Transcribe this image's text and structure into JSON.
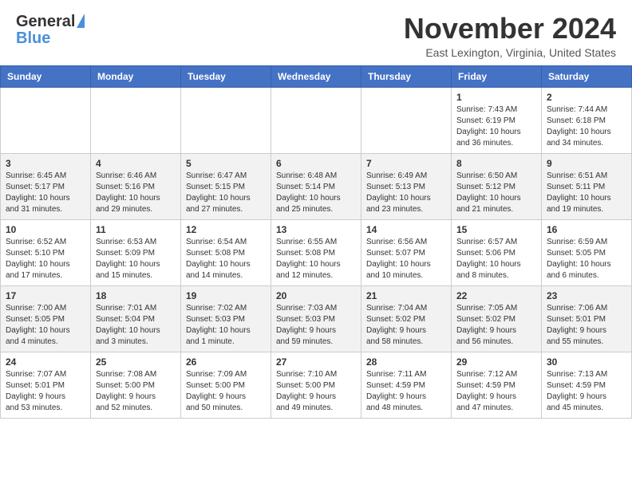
{
  "header": {
    "logo_general": "General",
    "logo_blue": "Blue",
    "title": "November 2024",
    "location": "East Lexington, Virginia, United States"
  },
  "calendar": {
    "days_of_week": [
      "Sunday",
      "Monday",
      "Tuesday",
      "Wednesday",
      "Thursday",
      "Friday",
      "Saturday"
    ],
    "weeks": [
      [
        {
          "day": "",
          "info": ""
        },
        {
          "day": "",
          "info": ""
        },
        {
          "day": "",
          "info": ""
        },
        {
          "day": "",
          "info": ""
        },
        {
          "day": "",
          "info": ""
        },
        {
          "day": "1",
          "info": "Sunrise: 7:43 AM\nSunset: 6:19 PM\nDaylight: 10 hours\nand 36 minutes."
        },
        {
          "day": "2",
          "info": "Sunrise: 7:44 AM\nSunset: 6:18 PM\nDaylight: 10 hours\nand 34 minutes."
        }
      ],
      [
        {
          "day": "3",
          "info": "Sunrise: 6:45 AM\nSunset: 5:17 PM\nDaylight: 10 hours\nand 31 minutes."
        },
        {
          "day": "4",
          "info": "Sunrise: 6:46 AM\nSunset: 5:16 PM\nDaylight: 10 hours\nand 29 minutes."
        },
        {
          "day": "5",
          "info": "Sunrise: 6:47 AM\nSunset: 5:15 PM\nDaylight: 10 hours\nand 27 minutes."
        },
        {
          "day": "6",
          "info": "Sunrise: 6:48 AM\nSunset: 5:14 PM\nDaylight: 10 hours\nand 25 minutes."
        },
        {
          "day": "7",
          "info": "Sunrise: 6:49 AM\nSunset: 5:13 PM\nDaylight: 10 hours\nand 23 minutes."
        },
        {
          "day": "8",
          "info": "Sunrise: 6:50 AM\nSunset: 5:12 PM\nDaylight: 10 hours\nand 21 minutes."
        },
        {
          "day": "9",
          "info": "Sunrise: 6:51 AM\nSunset: 5:11 PM\nDaylight: 10 hours\nand 19 minutes."
        }
      ],
      [
        {
          "day": "10",
          "info": "Sunrise: 6:52 AM\nSunset: 5:10 PM\nDaylight: 10 hours\nand 17 minutes."
        },
        {
          "day": "11",
          "info": "Sunrise: 6:53 AM\nSunset: 5:09 PM\nDaylight: 10 hours\nand 15 minutes."
        },
        {
          "day": "12",
          "info": "Sunrise: 6:54 AM\nSunset: 5:08 PM\nDaylight: 10 hours\nand 14 minutes."
        },
        {
          "day": "13",
          "info": "Sunrise: 6:55 AM\nSunset: 5:08 PM\nDaylight: 10 hours\nand 12 minutes."
        },
        {
          "day": "14",
          "info": "Sunrise: 6:56 AM\nSunset: 5:07 PM\nDaylight: 10 hours\nand 10 minutes."
        },
        {
          "day": "15",
          "info": "Sunrise: 6:57 AM\nSunset: 5:06 PM\nDaylight: 10 hours\nand 8 minutes."
        },
        {
          "day": "16",
          "info": "Sunrise: 6:59 AM\nSunset: 5:05 PM\nDaylight: 10 hours\nand 6 minutes."
        }
      ],
      [
        {
          "day": "17",
          "info": "Sunrise: 7:00 AM\nSunset: 5:05 PM\nDaylight: 10 hours\nand 4 minutes."
        },
        {
          "day": "18",
          "info": "Sunrise: 7:01 AM\nSunset: 5:04 PM\nDaylight: 10 hours\nand 3 minutes."
        },
        {
          "day": "19",
          "info": "Sunrise: 7:02 AM\nSunset: 5:03 PM\nDaylight: 10 hours\nand 1 minute."
        },
        {
          "day": "20",
          "info": "Sunrise: 7:03 AM\nSunset: 5:03 PM\nDaylight: 9 hours\nand 59 minutes."
        },
        {
          "day": "21",
          "info": "Sunrise: 7:04 AM\nSunset: 5:02 PM\nDaylight: 9 hours\nand 58 minutes."
        },
        {
          "day": "22",
          "info": "Sunrise: 7:05 AM\nSunset: 5:02 PM\nDaylight: 9 hours\nand 56 minutes."
        },
        {
          "day": "23",
          "info": "Sunrise: 7:06 AM\nSunset: 5:01 PM\nDaylight: 9 hours\nand 55 minutes."
        }
      ],
      [
        {
          "day": "24",
          "info": "Sunrise: 7:07 AM\nSunset: 5:01 PM\nDaylight: 9 hours\nand 53 minutes."
        },
        {
          "day": "25",
          "info": "Sunrise: 7:08 AM\nSunset: 5:00 PM\nDaylight: 9 hours\nand 52 minutes."
        },
        {
          "day": "26",
          "info": "Sunrise: 7:09 AM\nSunset: 5:00 PM\nDaylight: 9 hours\nand 50 minutes."
        },
        {
          "day": "27",
          "info": "Sunrise: 7:10 AM\nSunset: 5:00 PM\nDaylight: 9 hours\nand 49 minutes."
        },
        {
          "day": "28",
          "info": "Sunrise: 7:11 AM\nSunset: 4:59 PM\nDaylight: 9 hours\nand 48 minutes."
        },
        {
          "day": "29",
          "info": "Sunrise: 7:12 AM\nSunset: 4:59 PM\nDaylight: 9 hours\nand 47 minutes."
        },
        {
          "day": "30",
          "info": "Sunrise: 7:13 AM\nSunset: 4:59 PM\nDaylight: 9 hours\nand 45 minutes."
        }
      ]
    ]
  }
}
